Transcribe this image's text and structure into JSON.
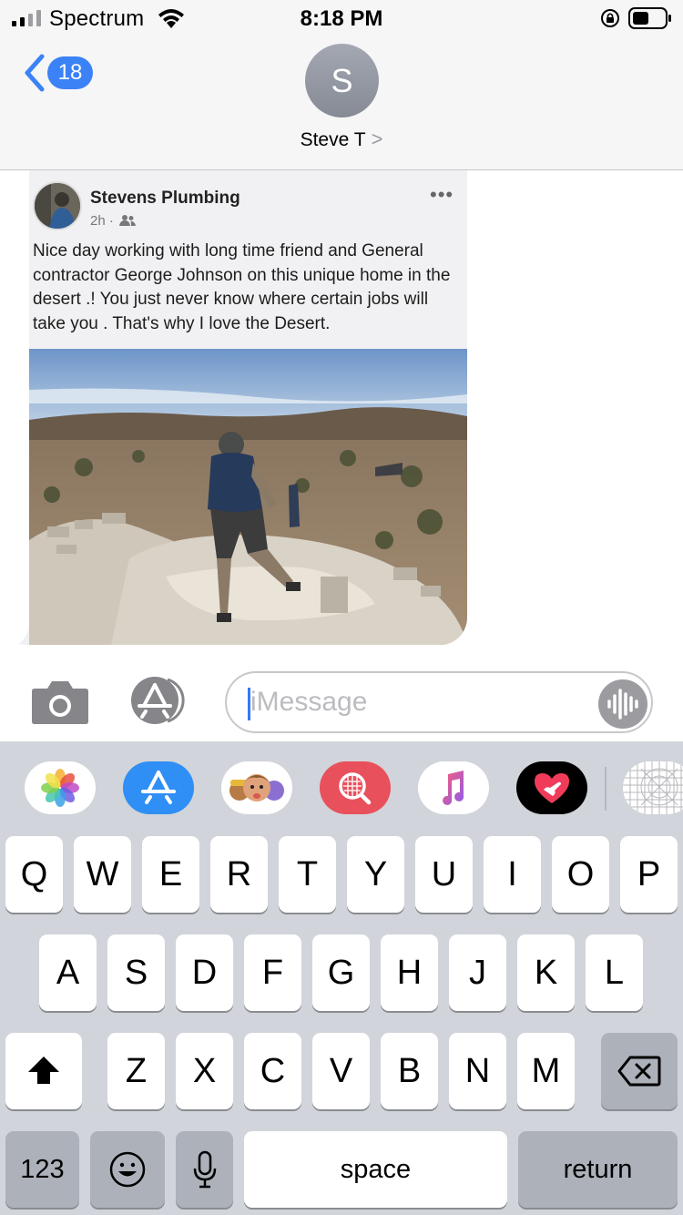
{
  "status_bar": {
    "carrier": "Spectrum",
    "time": "8:18 PM"
  },
  "header": {
    "back_count": "18",
    "avatar_initial": "S",
    "contact_name": "Steve T",
    "contact_chevron": ">"
  },
  "post": {
    "author": "Stevens Plumbing",
    "time": "2h ·",
    "more": "•••",
    "text": "Nice day working with long time friend and General contractor George Johnson on this unique home in the desert .!  You just never know where certain jobs will take you . That's why I love the Desert."
  },
  "compose": {
    "placeholder": "iMessage"
  },
  "app_strip": [
    "photos-app",
    "app-store-app",
    "memoji-app",
    "search-images-app",
    "music-app",
    "digital-touch-app",
    "more-apps"
  ],
  "keyboard": {
    "row1": [
      "Q",
      "W",
      "E",
      "R",
      "T",
      "Y",
      "U",
      "I",
      "O",
      "P"
    ],
    "row2": [
      "A",
      "S",
      "D",
      "F",
      "G",
      "H",
      "J",
      "K",
      "L"
    ],
    "row3": [
      "Z",
      "X",
      "C",
      "V",
      "B",
      "N",
      "M"
    ],
    "numbers_key": "123",
    "space_key": "space",
    "return_key": "return"
  },
  "colors": {
    "accent_blue": "#3b82f6",
    "avatar_grey": "#9a9ea8",
    "keyboard_bg": "#d1d4da"
  }
}
